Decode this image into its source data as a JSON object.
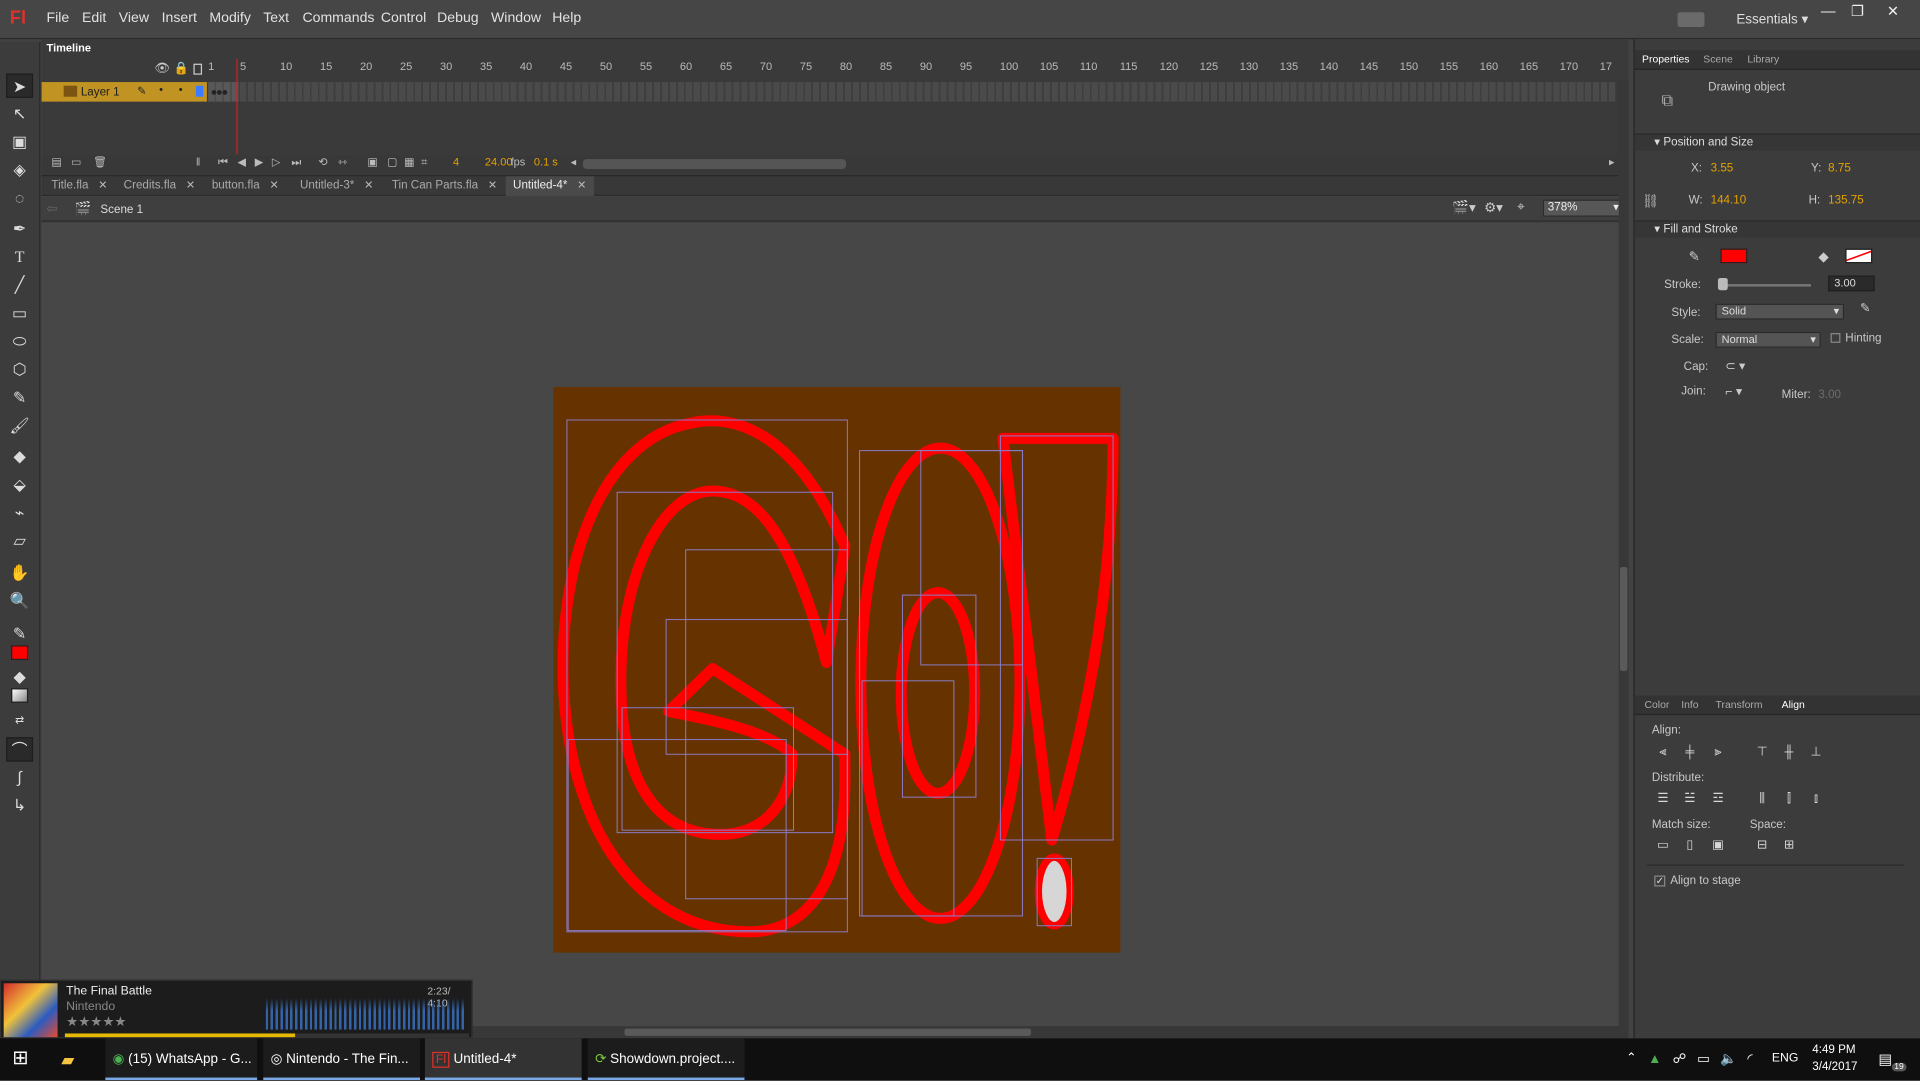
{
  "app": {
    "logo": "Fl",
    "workspace": "Essentials"
  },
  "menu": [
    "File",
    "Edit",
    "View",
    "Insert",
    "Modify",
    "Text",
    "Commands",
    "Control",
    "Debug",
    "Window",
    "Help"
  ],
  "timeline": {
    "title": "Timeline",
    "frame_numbers": [
      "1",
      "5",
      "10",
      "15",
      "20",
      "25",
      "30",
      "35",
      "40",
      "45",
      "50",
      "55",
      "60",
      "65",
      "70",
      "75",
      "80",
      "85",
      "90",
      "95",
      "100",
      "105",
      "110",
      "115",
      "120",
      "125",
      "130",
      "135",
      "140",
      "145",
      "150",
      "155",
      "160",
      "165",
      "170",
      "17"
    ],
    "layer_name": "Layer 1",
    "current_frame": "4",
    "fps": "24.00",
    "fps_unit": "fps",
    "time": "0.1 s"
  },
  "doc_tabs": [
    {
      "label": "Title.fla",
      "active": false
    },
    {
      "label": "Credits.fla",
      "active": false
    },
    {
      "label": "button.fla",
      "active": false
    },
    {
      "label": "Untitled-3*",
      "active": false
    },
    {
      "label": "Tin Can Parts.fla",
      "active": false
    },
    {
      "label": "Untitled-4*",
      "active": true
    }
  ],
  "edit_bar": {
    "scene": "Scene 1",
    "zoom": "378%"
  },
  "stage": {
    "background": "#663300",
    "stroke_color": "#ff0000"
  },
  "properties": {
    "tabs": [
      "Properties",
      "Scene",
      "Library"
    ],
    "object_type": "Drawing object",
    "position_size_header": "Position and Size",
    "x_label": "X:",
    "x": "3.55",
    "y_label": "Y:",
    "y": "8.75",
    "w_label": "W:",
    "w": "144.10",
    "h_label": "H:",
    "h": "135.75",
    "fill_stroke_header": "Fill and Stroke",
    "stroke_label": "Stroke:",
    "stroke": "3.00",
    "style_label": "Style:",
    "style": "Solid",
    "scale_label": "Scale:",
    "scale": "Normal",
    "hinting": "Hinting",
    "cap_label": "Cap:",
    "join_label": "Join:",
    "miter_label": "Miter:",
    "miter": "3.00",
    "stroke_swatch": "#ff0000"
  },
  "align_panel": {
    "tabs": [
      "Color",
      "Info",
      "Transform",
      "Align"
    ],
    "align_label": "Align:",
    "distribute_label": "Distribute:",
    "match_size_label": "Match size:",
    "space_label": "Space:",
    "align_to_stage": "Align to stage"
  },
  "music": {
    "title": "The Final Battle",
    "artist": "Nintendo",
    "time": "2:23/ 4:10",
    "progress": 0.57,
    "rating": "★★★★★"
  },
  "taskbar": {
    "items": [
      "(15) WhatsApp - G...",
      "Nintendo - The Fin...",
      "Untitled-4*",
      "Showdown.project...."
    ],
    "lang": "ENG",
    "time": "4:49 PM",
    "date": "3/4/2017",
    "notifications": "19"
  }
}
